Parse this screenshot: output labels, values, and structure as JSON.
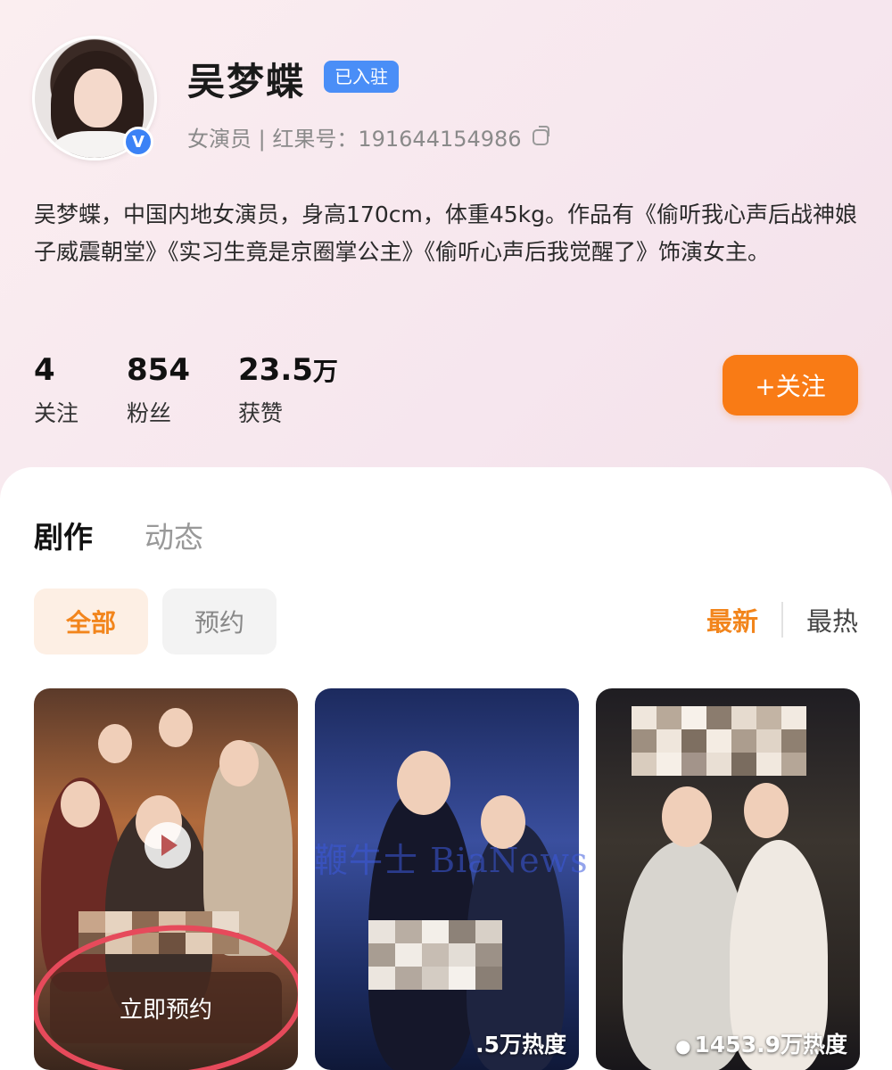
{
  "profile": {
    "name": "吴梦蝶",
    "badge": "已入驻",
    "verified_mark": "V",
    "subtitle": "女演员 | 红果号：191644154986",
    "bio": "吴梦蝶，中国内地女演员，身高170cm，体重45kg。作品有《偷听我心声后战神娘子威震朝堂》《实习生竟是京圈掌公主》《偷听心声后我觉醒了》饰演女主。"
  },
  "stats": [
    {
      "value": "4",
      "unit": "",
      "label": "关注"
    },
    {
      "value": "854",
      "unit": "",
      "label": "粉丝"
    },
    {
      "value": "23.5",
      "unit": "万",
      "label": "获赞"
    }
  ],
  "follow_button": "+关注",
  "tabs": [
    {
      "label": "剧作",
      "active": true
    },
    {
      "label": "动态",
      "active": false
    }
  ],
  "filters": [
    {
      "label": "全部",
      "active": true
    },
    {
      "label": "预约",
      "active": false
    }
  ],
  "sort": {
    "newest": "最新",
    "hottest": "最热"
  },
  "posters": [
    {
      "action_button": "立即预约"
    },
    {
      "heat": ".5万热度"
    },
    {
      "heat": "1453.9万热度"
    }
  ],
  "watermark": "鞭牛士 BiaNews",
  "colors": {
    "accent": "#f97b15",
    "badge": "#4a8ef7",
    "circle": "#e64a5b"
  }
}
